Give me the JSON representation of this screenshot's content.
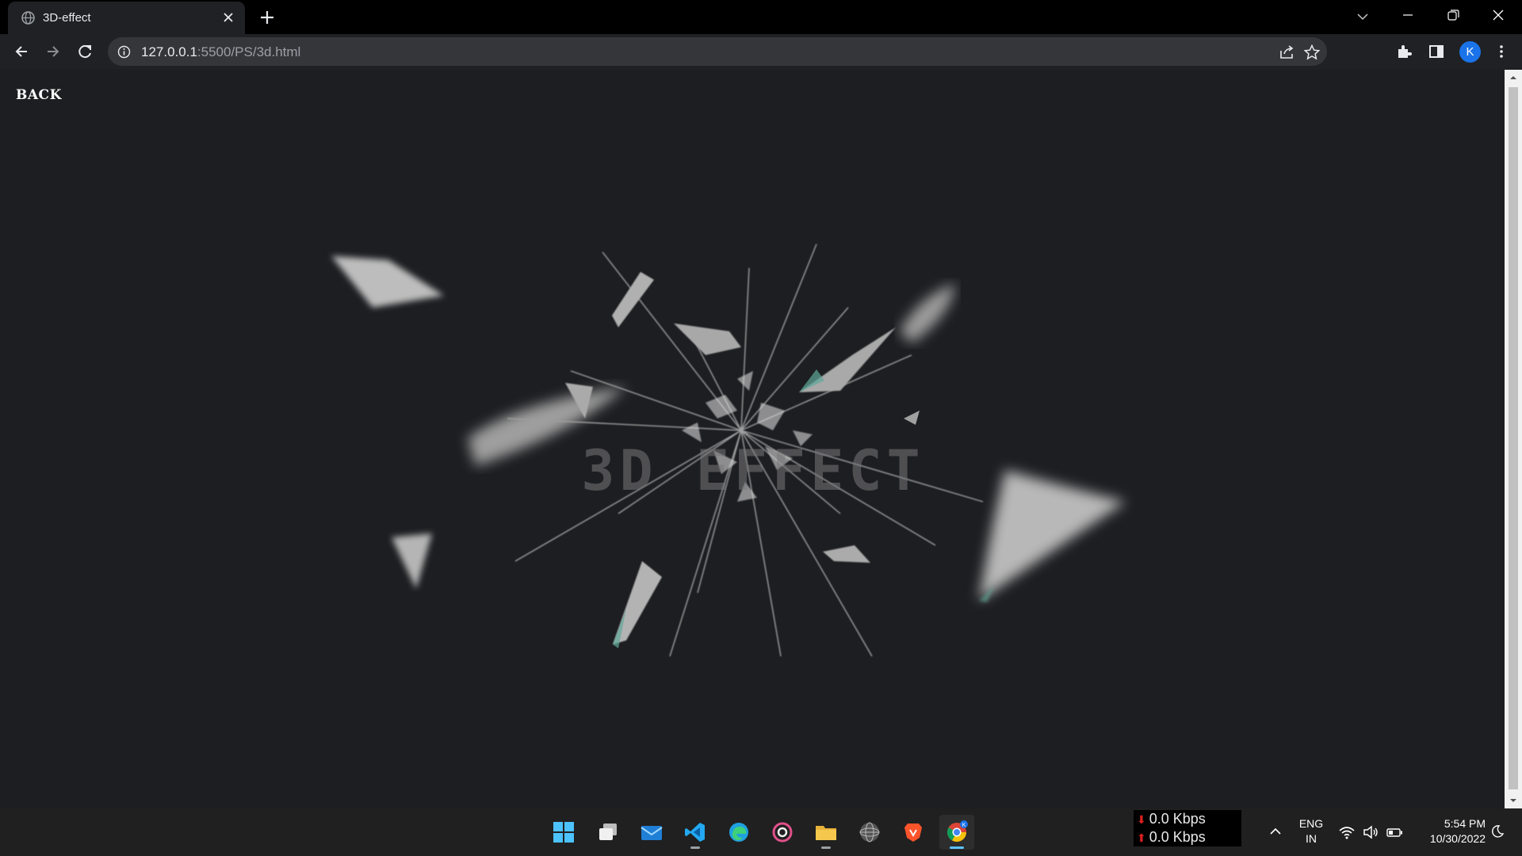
{
  "browser": {
    "tab": {
      "title": "3D-effect",
      "favicon": "globe-icon"
    },
    "address": {
      "host": "127.0.0.1",
      "path": ":5500/PS/3d.html"
    },
    "profile_initial": "K",
    "icons": [
      "back-arrow-icon",
      "forward-arrow-icon",
      "reload-icon",
      "site-info-icon",
      "share-icon",
      "star-icon",
      "extensions-icon",
      "side-panel-icon",
      "menu-kebab-icon",
      "tab-search-chevron-icon",
      "minimize-icon",
      "restore-icon",
      "close-icon"
    ]
  },
  "page": {
    "back_label": "BACK",
    "effect_title": "3D EFFECT",
    "scene_colors": {
      "background": "#1d1e21",
      "shard": "#b8b8b8",
      "shard_edge": "#5fa89a",
      "crack": "#d8d8d8"
    }
  },
  "taskbar": {
    "apps": [
      {
        "name": "windows-start",
        "icon": "windows-logo-icon"
      },
      {
        "name": "task-view",
        "icon": "task-view-icon"
      },
      {
        "name": "mail",
        "icon": "mail-icon"
      },
      {
        "name": "vscode",
        "icon": "vscode-icon",
        "running": true
      },
      {
        "name": "edge",
        "icon": "edge-icon"
      },
      {
        "name": "music",
        "icon": "groove-music-icon"
      },
      {
        "name": "file-explorer",
        "icon": "folder-icon",
        "running": true
      },
      {
        "name": "globe-app",
        "icon": "wireframe-globe-icon"
      },
      {
        "name": "brave",
        "icon": "brave-lion-icon"
      },
      {
        "name": "chrome",
        "icon": "chrome-icon",
        "active": true,
        "badge": "K"
      }
    ],
    "netspeed": {
      "down": "0.0 Kbps",
      "up": "0.0 Kbps"
    },
    "language": {
      "line1": "ENG",
      "line2": "IN"
    },
    "clock": {
      "time": "5:54 PM",
      "date": "10/30/2022"
    },
    "tray_icons": [
      "chevron-up-icon",
      "wifi-icon",
      "volume-icon",
      "battery-icon",
      "focus-moon-icon"
    ]
  }
}
